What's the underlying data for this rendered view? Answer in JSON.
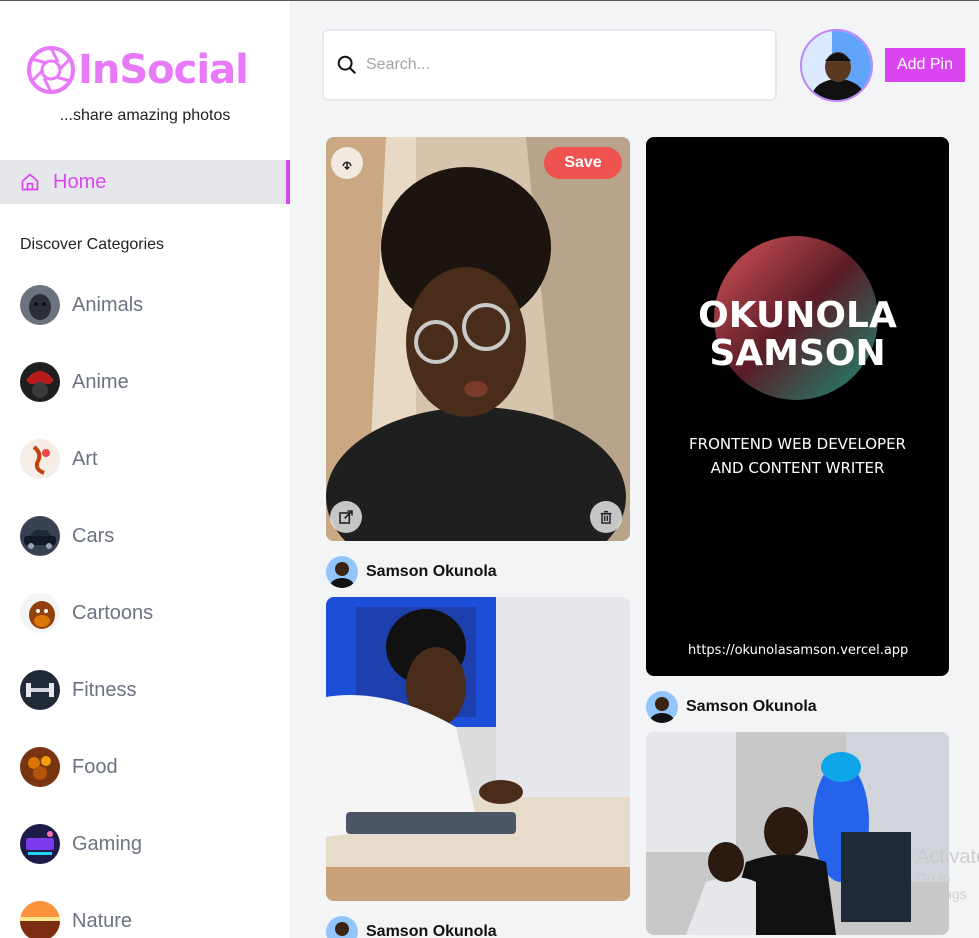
{
  "app": {
    "name": "InSocial",
    "tagline": "...share amazing photos",
    "brand_color": "#e879f9"
  },
  "sidebar": {
    "home_label": "Home",
    "discover_label": "Discover Categories",
    "categories": [
      {
        "label": "Animals"
      },
      {
        "label": "Anime"
      },
      {
        "label": "Art"
      },
      {
        "label": "Cars"
      },
      {
        "label": "Cartoons"
      },
      {
        "label": "Fitness"
      },
      {
        "label": "Food"
      },
      {
        "label": "Gaming"
      },
      {
        "label": "Nature"
      }
    ]
  },
  "header": {
    "search_placeholder": "Search...",
    "add_pin_label": "Add Pin"
  },
  "pins": {
    "save_label": "Save",
    "poster": {
      "line1": "OKUNOLA",
      "line2": "SAMSON",
      "subtitle1": "FRONTEND WEB DEVELOPER",
      "subtitle2": "AND CONTENT WRITER",
      "url": "https://okunolasamson.vercel.app"
    },
    "authors": [
      {
        "name": "Samson Okunola"
      },
      {
        "name": "Samson Okunola"
      },
      {
        "name": "Samson Okunola"
      }
    ]
  },
  "watermark": {
    "line1": "Activate",
    "line2": "Go to Settings"
  }
}
